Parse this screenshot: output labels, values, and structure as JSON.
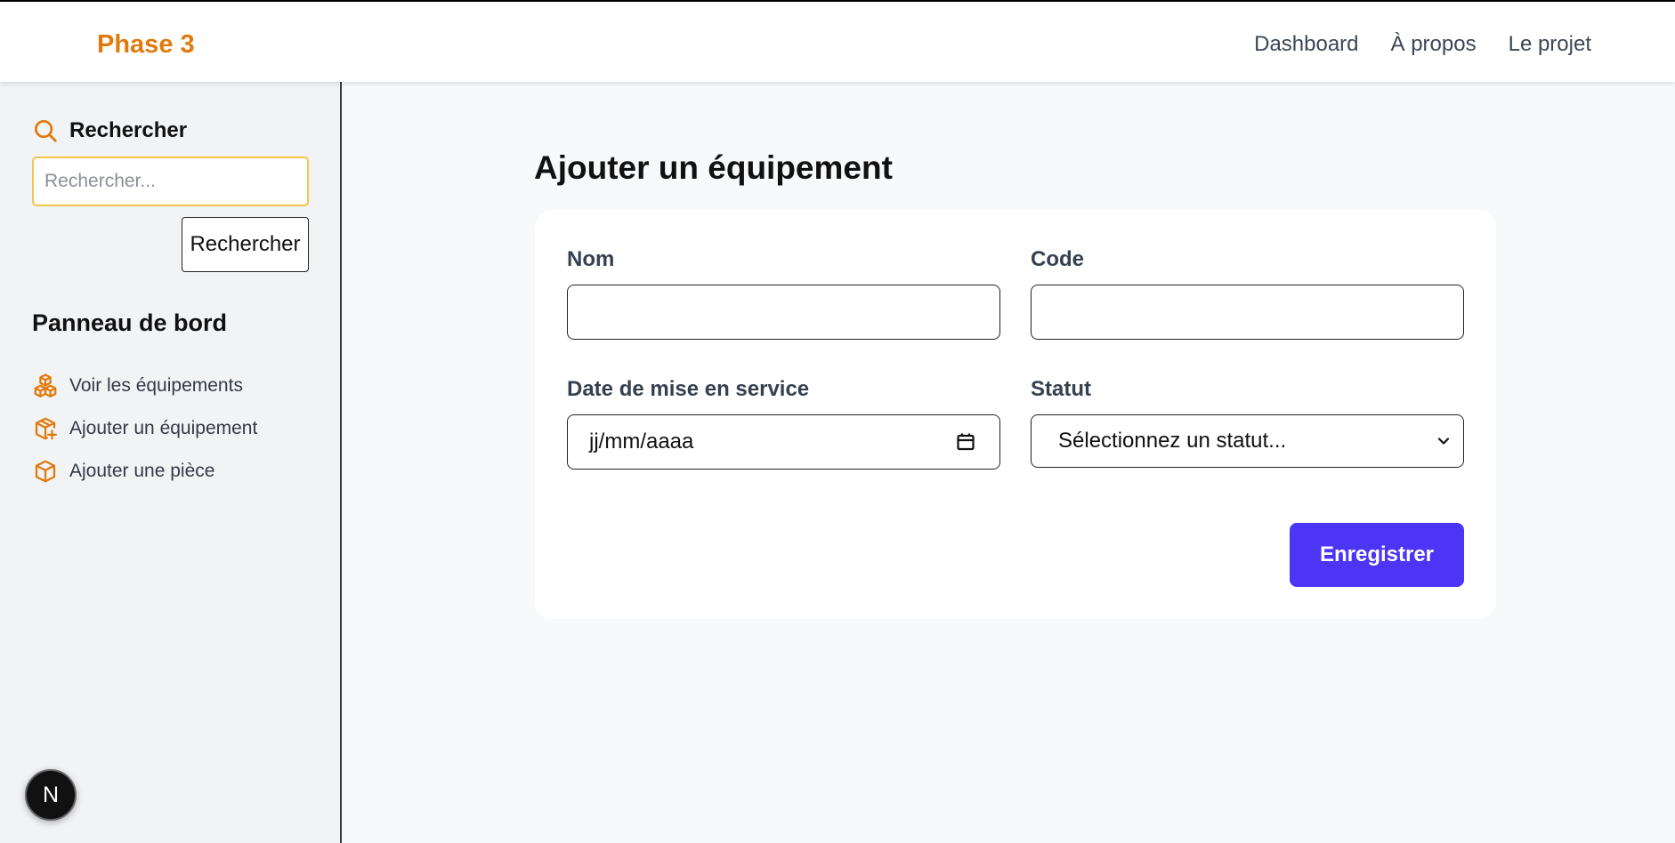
{
  "header": {
    "brand": "Phase 3",
    "nav": [
      "Dashboard",
      "À propos",
      "Le projet"
    ]
  },
  "sidebar": {
    "search_title": "Rechercher",
    "search_placeholder": "Rechercher...",
    "search_button": "Rechercher",
    "panel_title": "Panneau de bord",
    "items": [
      {
        "label": "Voir les équipements",
        "icon": "boxes-icon"
      },
      {
        "label": "Ajouter un équipement",
        "icon": "package-plus-icon"
      },
      {
        "label": "Ajouter une pièce",
        "icon": "box-icon"
      }
    ],
    "badge": "N"
  },
  "main": {
    "title": "Ajouter un équipement",
    "form": {
      "nom_label": "Nom",
      "nom_value": "",
      "code_label": "Code",
      "code_value": "",
      "date_label": "Date de mise en service",
      "date_placeholder": "jj/mm/aaaa",
      "statut_label": "Statut",
      "statut_selected": "Sélectionnez un statut...",
      "submit": "Enregistrer"
    }
  },
  "colors": {
    "brand": "#e07a0c",
    "accent": "#4c35f5",
    "search_border": "#f3c54a"
  }
}
